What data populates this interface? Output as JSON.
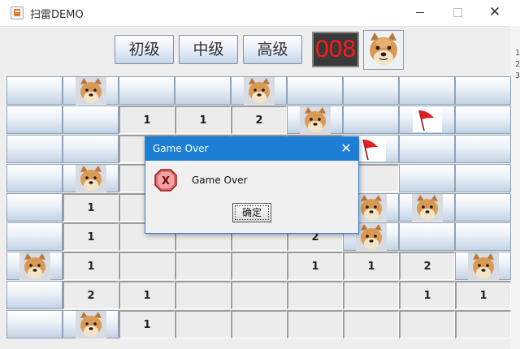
{
  "window": {
    "title": "扫雷DEMO",
    "close_glyph": "✕"
  },
  "toolbar": {
    "levels": [
      "初级",
      "中级",
      "高级"
    ],
    "counter": "008",
    "counter_color": "#ff1a1a"
  },
  "side_fragments": [
    "1",
    "2",
    "3"
  ],
  "board": {
    "rows": 9,
    "cols": 9,
    "cells": [
      [
        "c",
        "m",
        "c",
        "c",
        "m",
        "c",
        "c",
        "c",
        "c"
      ],
      [
        "c",
        "c",
        "1",
        "1",
        "2",
        "m",
        "c",
        "f",
        "c"
      ],
      [
        "c",
        "c",
        "r",
        "r",
        "r",
        "r",
        "f",
        "c",
        "c"
      ],
      [
        "c",
        "m",
        "r",
        "r",
        "r",
        "r",
        "r",
        "c",
        "c"
      ],
      [
        "c",
        "1",
        "r",
        "r",
        "r",
        "r",
        "m",
        "m",
        "c"
      ],
      [
        "c",
        "1",
        "r",
        "r",
        "r",
        "2",
        "m",
        "c",
        "c"
      ],
      [
        "m",
        "1",
        "r",
        "r",
        "r",
        "1",
        "1",
        "2",
        "m"
      ],
      [
        "c",
        "2",
        "1",
        "r",
        "r",
        "r",
        "r",
        "1",
        "1"
      ],
      [
        "c",
        "m",
        "1",
        "r",
        "r",
        "r",
        "r",
        "r",
        "r"
      ]
    ]
  },
  "dialog": {
    "title": "Game Over",
    "message": "Game Over",
    "ok_label": "确定",
    "close_glyph": "✕",
    "title_color": "#1c7fd4"
  }
}
